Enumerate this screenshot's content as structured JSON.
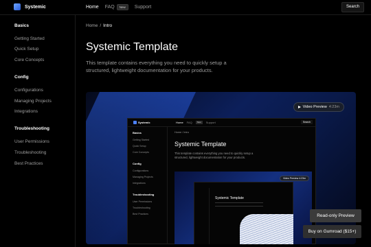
{
  "brand": {
    "name": "Systemic"
  },
  "nav": {
    "home": "Home",
    "faq": "FAQ",
    "faq_badge": "New",
    "support": "Support",
    "search": "Search"
  },
  "sidebar": {
    "sections": [
      {
        "title": "Basics",
        "items": [
          "Getting Started",
          "Quick Setup",
          "Core Concepts"
        ]
      },
      {
        "title": "Config",
        "items": [
          "Configurations",
          "Managing Projects",
          "Integrations"
        ]
      },
      {
        "title": "Troubleshooting",
        "items": [
          "User Permissions",
          "Troubleshooting",
          "Best Practices"
        ]
      }
    ]
  },
  "breadcrumb": {
    "root": "Home",
    "sep": "/",
    "current": "Intro"
  },
  "page": {
    "title": "Systemic Template",
    "description": "This template contains everything you need to quickly setup a structured, lightweight documentation for your products."
  },
  "preview": {
    "video_label": "Video Preview",
    "video_duration": "4:23m",
    "readonly_label": "Read-only Preview",
    "buy_label": "Buy on Gumroad ($15+)"
  },
  "colors": {
    "accent": "#2a5bd7",
    "background": "#000000",
    "muted_text": "#9c9c9c"
  }
}
